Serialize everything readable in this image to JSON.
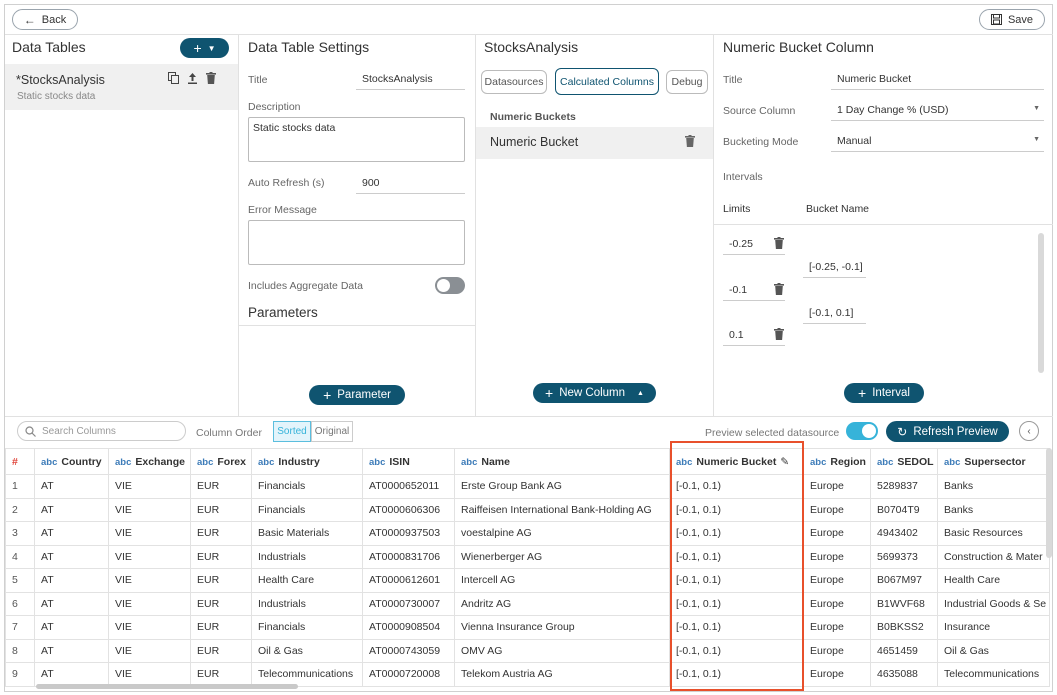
{
  "topbar": {
    "back_label": "Back",
    "save_label": "Save"
  },
  "data_tables": {
    "title": "Data Tables",
    "item_name": "*StocksAnalysis",
    "item_desc": "Static stocks data"
  },
  "settings": {
    "title": "Data Table Settings",
    "title_label": "Title",
    "title_value": "StocksAnalysis",
    "description_label": "Description",
    "description_value": "Static stocks data",
    "auto_refresh_label": "Auto Refresh (s)",
    "auto_refresh_value": "900",
    "error_label": "Error Message",
    "aggregate_label": "Includes Aggregate Data",
    "parameters_label": "Parameters",
    "parameter_button": "Parameter"
  },
  "stocks": {
    "title": "StocksAnalysis",
    "tabs": [
      "Datasources",
      "Calculated Columns",
      "Debug"
    ],
    "section_label": "Numeric Buckets",
    "item": "Numeric Bucket",
    "new_column_button": "New Column"
  },
  "bucket": {
    "title": "Numeric Bucket Column",
    "title_label": "Title",
    "title_value": "Numeric Bucket",
    "source_label": "Source Column",
    "source_value": "1 Day Change % (USD)",
    "mode_label": "Bucketing Mode",
    "mode_value": "Manual",
    "intervals_label": "Intervals",
    "limits_label": "Limits",
    "bucket_name_label": "Bucket Name",
    "limits": [
      "-0.25",
      "-0.1",
      "0.1"
    ],
    "bucket_names": [
      "[-0.25, -0.1]",
      "[-0.1, 0.1]"
    ],
    "interval_button": "Interval"
  },
  "preview": {
    "search_placeholder": "Search Columns",
    "column_order_label": "Column Order",
    "sorted_label": "Sorted",
    "original_label": "Original",
    "preview_selected_label": "Preview selected datasource",
    "refresh_button": "Refresh Preview"
  },
  "table": {
    "headers": [
      "#",
      "Country",
      "Exchange",
      "Forex",
      "Industry",
      "ISIN",
      "Name",
      "Numeric Bucket",
      "Region",
      "SEDOL",
      "Supersector"
    ],
    "type_tag": "abc",
    "rows": [
      [
        "1",
        "AT",
        "VIE",
        "EUR",
        "Financials",
        "AT0000652011",
        "Erste Group Bank AG",
        "[-0.1, 0.1)",
        "Europe",
        "5289837",
        "Banks"
      ],
      [
        "2",
        "AT",
        "VIE",
        "EUR",
        "Financials",
        "AT0000606306",
        "Raiffeisen International Bank-Holding AG",
        "[-0.1, 0.1)",
        "Europe",
        "B0704T9",
        "Banks"
      ],
      [
        "3",
        "AT",
        "VIE",
        "EUR",
        "Basic Materials",
        "AT0000937503",
        "voestalpine AG",
        "[-0.1, 0.1)",
        "Europe",
        "4943402",
        "Basic Resources"
      ],
      [
        "4",
        "AT",
        "VIE",
        "EUR",
        "Industrials",
        "AT0000831706",
        "Wienerberger AG",
        "[-0.1, 0.1)",
        "Europe",
        "5699373",
        "Construction & Mater"
      ],
      [
        "5",
        "AT",
        "VIE",
        "EUR",
        "Health Care",
        "AT0000612601",
        "Intercell AG",
        "[-0.1, 0.1)",
        "Europe",
        "B067M97",
        "Health Care"
      ],
      [
        "6",
        "AT",
        "VIE",
        "EUR",
        "Industrials",
        "AT0000730007",
        "Andritz AG",
        "[-0.1, 0.1)",
        "Europe",
        "B1WVF68",
        "Industrial Goods & Se"
      ],
      [
        "7",
        "AT",
        "VIE",
        "EUR",
        "Financials",
        "AT0000908504",
        "Vienna Insurance Group",
        "[-0.1, 0.1)",
        "Europe",
        "B0BKSS2",
        "Insurance"
      ],
      [
        "8",
        "AT",
        "VIE",
        "EUR",
        "Oil & Gas",
        "AT0000743059",
        "OMV AG",
        "[-0.1, 0.1)",
        "Europe",
        "4651459",
        "Oil & Gas"
      ],
      [
        "9",
        "AT",
        "VIE",
        "EUR",
        "Telecommunications",
        "AT0000720008",
        "Telekom Austria AG",
        "[-0.1, 0.1)",
        "Europe",
        "4635088",
        "Telecommunications"
      ]
    ]
  },
  "colors": {
    "primary": "#0f5470",
    "accent": "#36b3d9",
    "highlight": "#e8502b",
    "hash": "#e0443a",
    "type_tag": "#3c7bb8"
  }
}
